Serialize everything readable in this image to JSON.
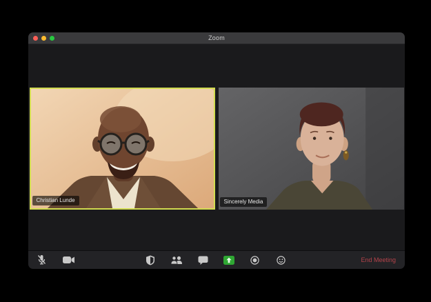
{
  "window": {
    "title": "Zoom",
    "traffic_lights": [
      "close",
      "minimize",
      "fullscreen"
    ]
  },
  "participants": [
    {
      "name": "Christian Lunde",
      "active_speaker": true
    },
    {
      "name": "Sincerely Media",
      "active_speaker": false
    }
  ],
  "toolbar": {
    "buttons": [
      {
        "id": "mute",
        "icon": "microphone-muted-icon"
      },
      {
        "id": "video",
        "icon": "video-camera-icon"
      },
      {
        "id": "security",
        "icon": "security-shield-icon"
      },
      {
        "id": "participants",
        "icon": "participants-icon"
      },
      {
        "id": "chat",
        "icon": "chat-bubble-icon"
      },
      {
        "id": "share-screen",
        "icon": "share-screen-icon"
      },
      {
        "id": "record",
        "icon": "record-icon"
      },
      {
        "id": "reactions",
        "icon": "reactions-smiley-icon"
      }
    ],
    "end_meeting_label": "End Meeting"
  },
  "colors": {
    "active_speaker_border": "#d2dc50",
    "share_screen_green": "#2fa733",
    "end_meeting_red": "#b5434b",
    "titlebar_bg": "#3a3a3c",
    "content_bg": "#1a1a1c",
    "toolbar_bg": "#232326"
  }
}
